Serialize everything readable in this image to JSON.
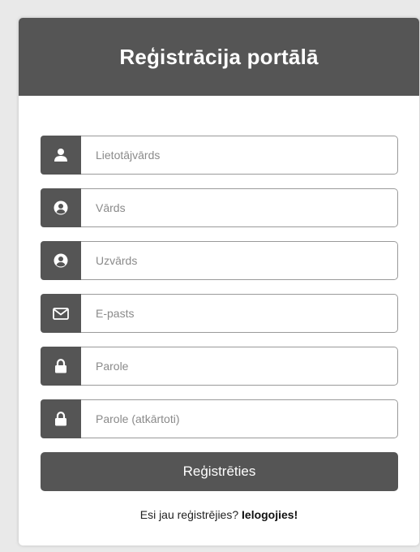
{
  "header": {
    "title": "Reģistrācija portālā"
  },
  "form": {
    "fields": [
      {
        "placeholder": "Lietotājvārds",
        "icon": "user-icon"
      },
      {
        "placeholder": "Vārds",
        "icon": "user-circle-icon"
      },
      {
        "placeholder": "Uzvārds",
        "icon": "user-circle-icon"
      },
      {
        "placeholder": "E-pasts",
        "icon": "envelope-icon"
      },
      {
        "placeholder": "Parole",
        "icon": "lock-icon"
      },
      {
        "placeholder": "Parole (atkārtoti)",
        "icon": "lock-icon"
      }
    ],
    "submit_label": "Reģistrēties"
  },
  "footer": {
    "prompt": "Esi jau reģistrējies?",
    "login_link": "Ielogojies!"
  },
  "colors": {
    "accent": "#555555",
    "background": "#e9e9e9",
    "card": "#ffffff"
  }
}
